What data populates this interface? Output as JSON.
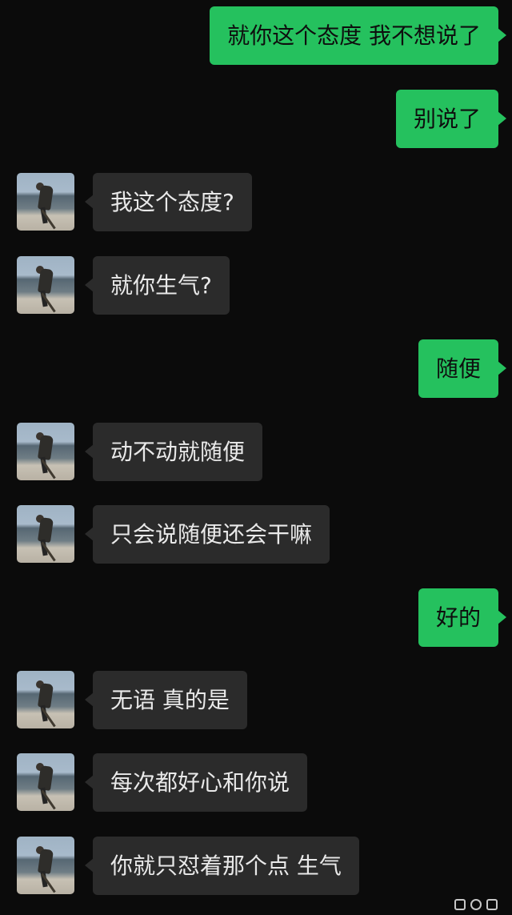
{
  "messages": [
    {
      "from": "me",
      "text": "就你这个态度 我不想说了"
    },
    {
      "from": "me",
      "text": "别说了"
    },
    {
      "from": "them",
      "text": "我这个态度?"
    },
    {
      "from": "them",
      "text": "就你生气?"
    },
    {
      "from": "me",
      "text": "随便"
    },
    {
      "from": "them",
      "text": "动不动就随便"
    },
    {
      "from": "them",
      "text": "只会说随便还会干嘛"
    },
    {
      "from": "me",
      "text": "好的"
    },
    {
      "from": "them",
      "text": "无语 真的是"
    },
    {
      "from": "them",
      "text": "每次都好心和你说"
    },
    {
      "from": "them",
      "text": "你就只怼着那个点 生气"
    }
  ],
  "colors": {
    "background": "#0b0b0b",
    "my_bubble": "#25c15e",
    "their_bubble": "#2b2b2b",
    "their_text": "#e9e9e9"
  },
  "avatar": {
    "icon": "beach-figure-avatar"
  }
}
